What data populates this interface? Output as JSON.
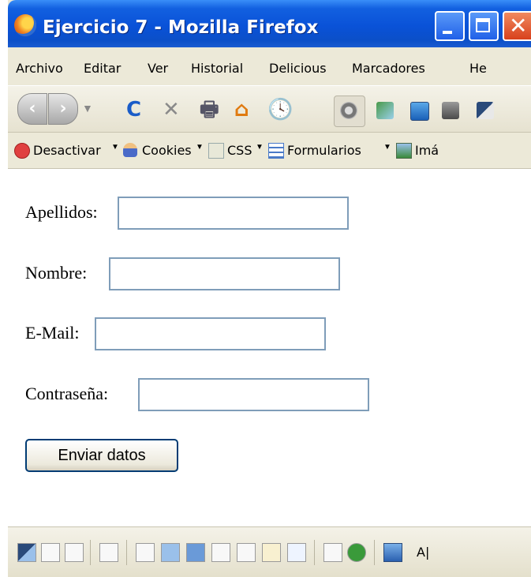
{
  "window": {
    "title": "Ejercicio 7 - Mozilla Firefox",
    "close_glyph": "✕"
  },
  "menu": [
    "Archivo",
    "Editar",
    "Ver",
    "Historial",
    "Delicious",
    "Marcadores",
    "He"
  ],
  "nav": {
    "back": "‹",
    "forward": "›",
    "dropdown": "▼",
    "reload": "C",
    "stop": "✕",
    "print": "🖶",
    "home": "⌂",
    "history": "🕓"
  },
  "webdev_toolbar": {
    "disable_label": "Desactivar",
    "cookies_label": "Cookies",
    "css_label": "CSS",
    "forms_label": "Formularios",
    "images_label": "Imá",
    "dropdown_marker": "▼"
  },
  "form": {
    "apellidos_label": "Apellidos:",
    "apellidos_value": "",
    "nombre_label": "Nombre:",
    "nombre_value": "",
    "email_label": "E-Mail:",
    "email_value": "",
    "password_label": "Contraseña:",
    "password_value": "",
    "submit_label": "Enviar datos"
  },
  "bottom": {
    "text": "A|"
  }
}
